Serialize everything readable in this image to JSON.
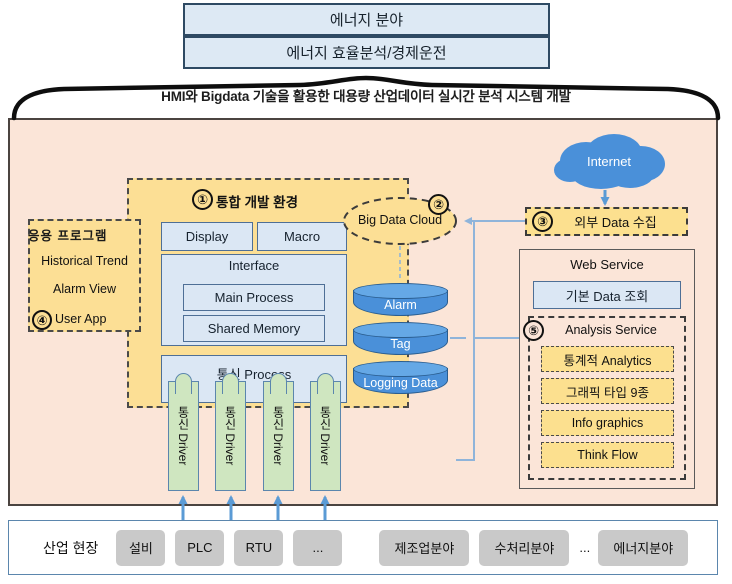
{
  "header": {
    "banner_top": "에너지 분야",
    "banner_sub": "에너지 효율분석/경제운전"
  },
  "project": {
    "title": "HMI와 Bigdata 기술을 활용한 대용량 산업데이터 실시간 분석 시스템 개발"
  },
  "ide": {
    "number": "①",
    "title": "통합 개발 환경",
    "display": "Display",
    "macro": "Macro",
    "interface": "Interface",
    "main_process": "Main Process",
    "shared_memory": "Shared Memory",
    "comm_process": "통신 Process"
  },
  "app_program": {
    "number": "④",
    "title": "응용 프로그램",
    "items": [
      "Historical Trend",
      "Alarm View",
      "User App"
    ]
  },
  "databases": [
    {
      "label": "Alarm"
    },
    {
      "label": "Tag"
    },
    {
      "label": "Logging Data"
    }
  ],
  "bigdata_cloud": {
    "number": "②",
    "label": "Big Data Cloud"
  },
  "internet": {
    "label": "Internet"
  },
  "external_data": {
    "number": "③",
    "label": "외부 Data 수집"
  },
  "web_service": {
    "title": "Web Service",
    "basic_query": "기본 Data 조회",
    "analysis": {
      "number": "⑤",
      "title": "Analysis Service",
      "items": [
        "통계적 Analytics",
        "그래픽 타입 9종",
        "Info graphics",
        "Think Flow"
      ]
    }
  },
  "drivers": [
    {
      "label": "통신 Driver"
    },
    {
      "label": "통신 Driver"
    },
    {
      "label": "통신 Driver"
    },
    {
      "label": "통신 Driver"
    }
  ],
  "bottom": {
    "label": "산업 현장",
    "devices": [
      "설비",
      "PLC",
      "RTU",
      "..."
    ],
    "fields": [
      "제조업분야",
      "수처리분야"
    ],
    "fields_dots": "...",
    "fields_last": "에너지분야"
  },
  "colors": {
    "banner_bg": "#dde9f4",
    "banner_border": "#2e4a63",
    "outer_bg": "#fbe5d8",
    "ide_bg": "#fcdf95",
    "blue_box": "#dbe7f4",
    "db_blue": "#4a90d9",
    "driver_green": "#cfe6c0",
    "chip_gray": "#c9c9c9",
    "arrow_blue": "#8fb4da"
  }
}
